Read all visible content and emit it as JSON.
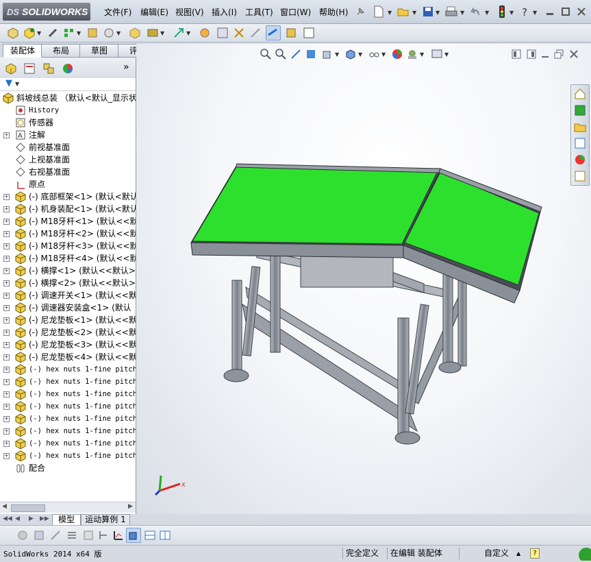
{
  "app": {
    "logo_prefix": "DS",
    "logo_text": "SOLIDWORKS"
  },
  "menu": [
    "文件(F)",
    "编辑(E)",
    "视图(V)",
    "插入(I)",
    "工具(T)",
    "窗口(W)",
    "帮助(H)"
  ],
  "tabs": [
    "装配体",
    "布局",
    "草图",
    "评估"
  ],
  "tree": {
    "root": "斜坡线总装 （默认<默认_显示状",
    "items": [
      {
        "label": "History",
        "mono": true
      },
      {
        "label": "传感器"
      },
      {
        "label": "注解",
        "expand": true
      },
      {
        "label": "前视基准面"
      },
      {
        "label": "上视基准面"
      },
      {
        "label": "右视基准面"
      },
      {
        "label": "原点"
      },
      {
        "label": "(-) 底部框架<1> (默认<默认",
        "expand": true
      },
      {
        "label": "(-) 机身装配<1> (默认<默认",
        "expand": true
      },
      {
        "label": "(-) M18牙杆<1> (默认<<默认",
        "expand": true
      },
      {
        "label": "(-) M18牙杆<2> (默认<<默认",
        "expand": true
      },
      {
        "label": "(-) M18牙杆<3> (默认<<默认",
        "expand": true
      },
      {
        "label": "(-) M18牙杆<4> (默认<<默认",
        "expand": true
      },
      {
        "label": "(-) 横撑<1> (默认<<默认>_",
        "expand": true
      },
      {
        "label": "(-) 横撑<2> (默认<<默认>_",
        "expand": true
      },
      {
        "label": "(-) 调速开关<1> (默认<<默认",
        "expand": true
      },
      {
        "label": "(-) 调速器安装盒<1> (默认",
        "expand": true
      },
      {
        "label": "(-) 尼龙垫板<1> (默认<<默",
        "expand": true
      },
      {
        "label": "(-) 尼龙垫板<2> (默认<<默",
        "expand": true
      },
      {
        "label": "(-) 尼龙垫板<3> (默认<<默",
        "expand": true
      },
      {
        "label": "(-) 尼龙垫板<4> (默认<<默",
        "expand": true
      },
      {
        "label": "(-) hex nuts 1-fine pitch",
        "expand": true,
        "mono": true
      },
      {
        "label": "(-) hex nuts 1-fine pitch",
        "expand": true,
        "mono": true
      },
      {
        "label": "(-) hex nuts 1-fine pitch",
        "expand": true,
        "mono": true
      },
      {
        "label": "(-) hex nuts 1-fine pitch",
        "expand": true,
        "mono": true
      },
      {
        "label": "(-) hex nuts 1-fine pitch",
        "expand": true,
        "mono": true
      },
      {
        "label": "(-) hex nuts 1-fine pitch",
        "expand": true,
        "mono": true
      },
      {
        "label": "(-) hex nuts 1-fine pitch",
        "expand": true,
        "mono": true
      },
      {
        "label": "(-) hex nuts 1-fine pitch",
        "expand": true,
        "mono": true
      },
      {
        "label": "配合"
      }
    ]
  },
  "bottom_tabs": [
    "模型",
    "运动算例 1"
  ],
  "status": {
    "version": "SolidWorks 2014 x64 版",
    "definition": "完全定义",
    "editing": "在编辑 装配体",
    "units": "自定义",
    "help": "?"
  },
  "colors": {
    "belt": "#2ee02e",
    "frame": "#9aa0a8",
    "accent": "#1f6fd0"
  }
}
